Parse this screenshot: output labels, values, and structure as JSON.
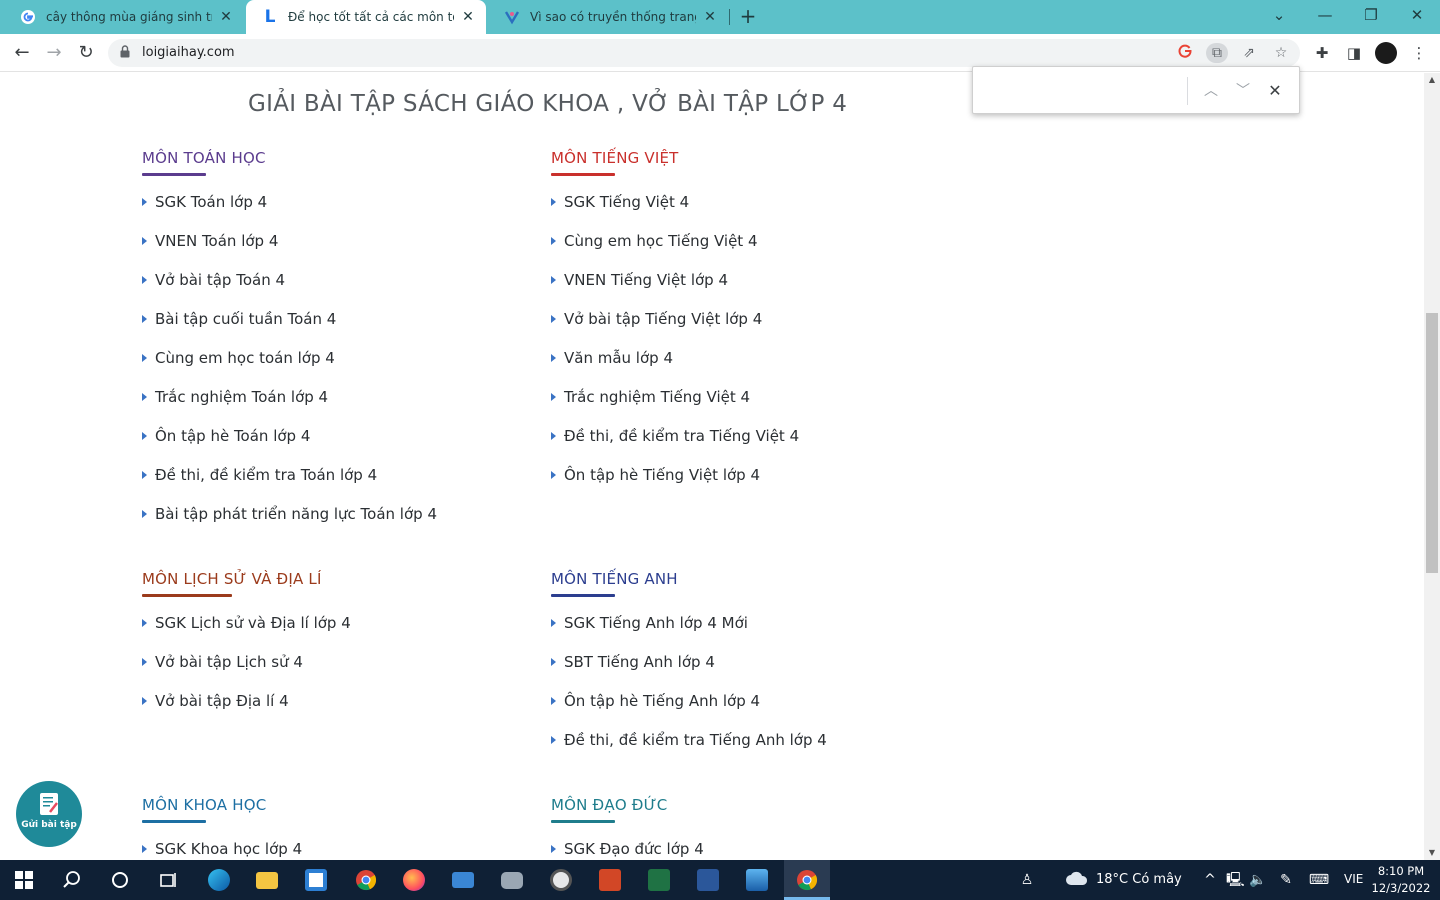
{
  "browser": {
    "tabs": [
      {
        "title": "cây thông mùa giáng sinh trong",
        "favicon": "google-icon"
      },
      {
        "title": "Để học tốt tất cả các môn toán, v",
        "favicon": "loigiaihay-icon",
        "active": true
      },
      {
        "title": "Vì sao có truyền thống trang trí v",
        "favicon": "site-icon"
      }
    ],
    "url": "loigiaihay.com"
  },
  "page": {
    "title": "GIẢI BÀI TẬP SÁCH GIÁO KHOA , VỞ BÀI TẬP LỚP 4",
    "sections": {
      "toan": {
        "heading": "MÔN TOÁN HỌC",
        "color": "#5b3c8e",
        "items": [
          "SGK Toán lớp 4",
          "VNEN Toán lớp 4",
          "Vở bài tập Toán 4",
          "Bài tập cuối tuần Toán 4",
          "Cùng em học toán lớp 4",
          "Trắc nghiệm Toán lớp 4",
          "Ôn tập hè Toán lớp 4",
          "Đề thi, đề kiểm tra Toán lớp 4",
          "Bài tập phát triển năng lực Toán lớp 4"
        ]
      },
      "tiengviet": {
        "heading": "MÔN TIẾNG VIỆT",
        "color": "#c9302c",
        "items": [
          "SGK Tiếng Việt 4",
          "Cùng em học Tiếng Việt 4",
          "VNEN Tiếng Việt lớp 4",
          "Vở bài tập Tiếng Việt lớp 4",
          "Văn mẫu lớp 4",
          "Trắc nghiệm Tiếng Việt 4",
          "Đề thi, đề kiểm tra Tiếng Việt 4",
          "Ôn tập hè Tiếng Việt lớp 4"
        ]
      },
      "lichsu": {
        "heading": "MÔN LỊCH SỬ VÀ ĐỊA LÍ",
        "color": "#9b3b1c",
        "items": [
          "SGK Lịch sử và Địa lí lớp 4",
          "Vở bài tập Lịch sử 4",
          "Vở bài tập Địa lí 4"
        ]
      },
      "tienganh": {
        "heading": "MÔN TIẾNG ANH",
        "color": "#2c3e8f",
        "items": [
          "SGK Tiếng Anh lớp 4 Mới",
          "SBT Tiếng Anh lớp 4",
          "Ôn tập hè Tiếng Anh lớp 4",
          "Đề thi, đề kiểm tra Tiếng Anh lớp 4"
        ]
      },
      "khoahoc": {
        "heading": "MÔN KHOA HỌC",
        "color": "#1d6fa3",
        "items": [
          "SGK Khoa học lớp 4"
        ]
      },
      "daoduc": {
        "heading": "MÔN ĐẠO ĐỨC",
        "color": "#1f7d8c",
        "items": [
          "SGK Đạo đức lớp 4"
        ]
      }
    },
    "float_button_label": "Gửi bài tập"
  },
  "findbar": {
    "value": ""
  },
  "taskbar": {
    "weather": "18°C  Có mây",
    "language": "VIE",
    "time": "8:10 PM",
    "date": "12/3/2022"
  }
}
